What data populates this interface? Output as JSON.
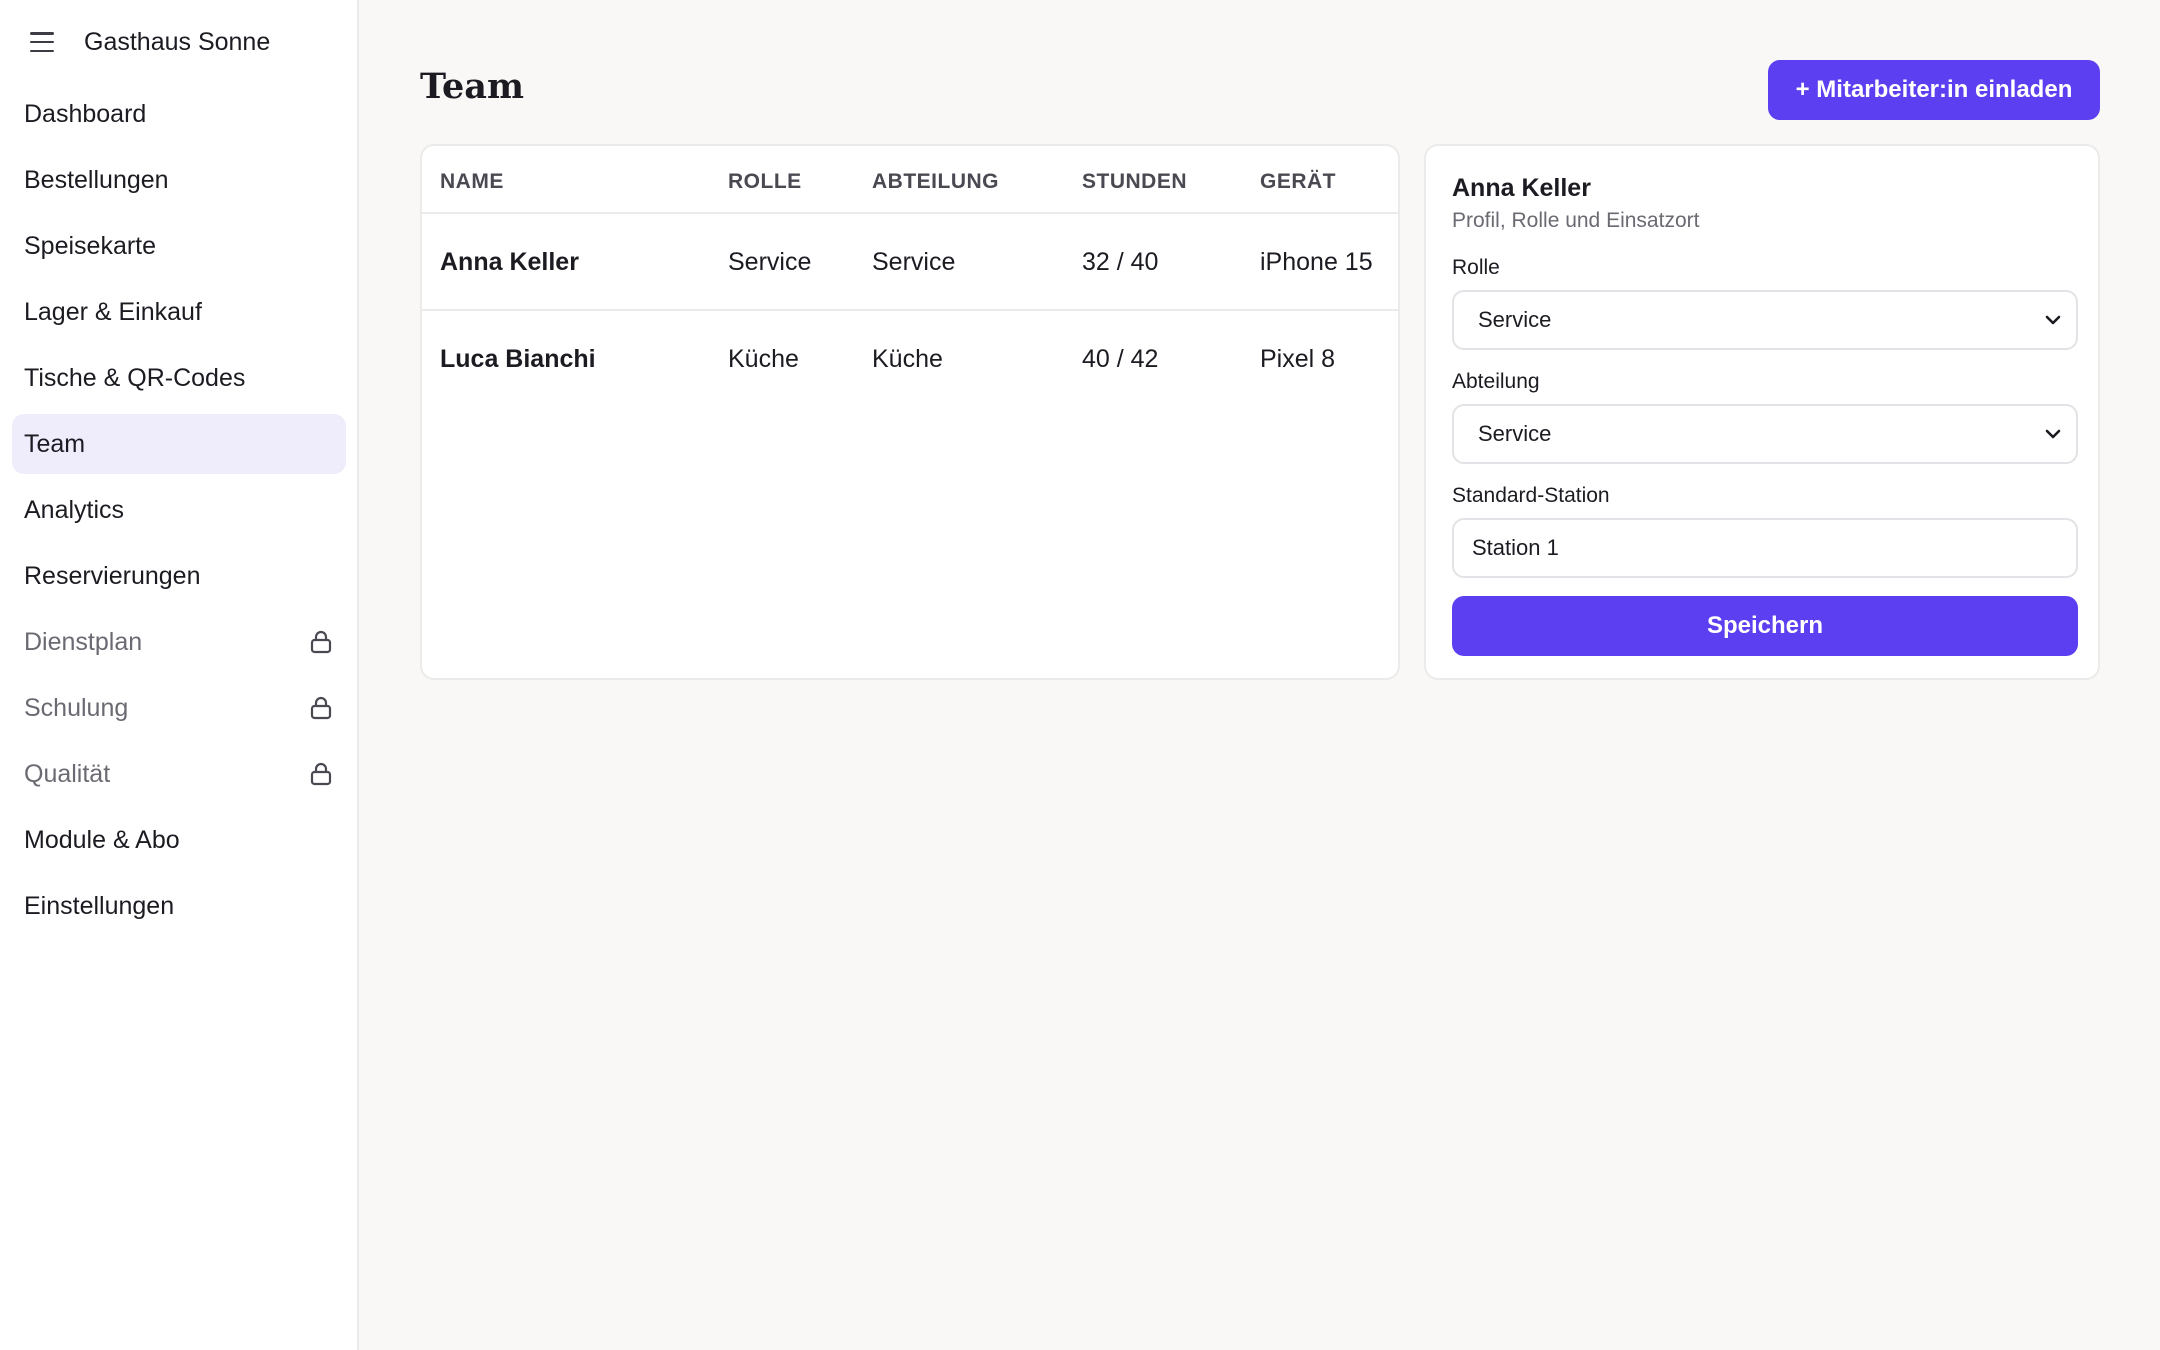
{
  "app": {
    "brand": "Gasthaus Sonne",
    "accent_color": "#5b3ff0"
  },
  "sidebar": {
    "items": [
      {
        "label": "Dashboard",
        "locked": false,
        "active": false
      },
      {
        "label": "Bestellungen",
        "locked": false,
        "active": false
      },
      {
        "label": "Speisekarte",
        "locked": false,
        "active": false
      },
      {
        "label": "Lager & Einkauf",
        "locked": false,
        "active": false
      },
      {
        "label": "Tische & QR-Codes",
        "locked": false,
        "active": false
      },
      {
        "label": "Team",
        "locked": false,
        "active": true
      },
      {
        "label": "Analytics",
        "locked": false,
        "active": false
      },
      {
        "label": "Reservierungen",
        "locked": false,
        "active": false
      },
      {
        "label": "Dienstplan",
        "locked": true,
        "active": false,
        "icon": "lock-icon"
      },
      {
        "label": "Schulung",
        "locked": true,
        "active": false,
        "icon": "lock-icon"
      },
      {
        "label": "Qualität",
        "locked": true,
        "active": false,
        "icon": "lock-icon"
      },
      {
        "label": "Module & Abo",
        "locked": false,
        "active": false
      },
      {
        "label": "Einstellungen",
        "locked": false,
        "active": false
      }
    ]
  },
  "page": {
    "title": "Team",
    "invite_label": "+ Mitarbeiter:in einladen"
  },
  "table": {
    "columns": [
      "NAME",
      "ROLLE",
      "ABTEILUNG",
      "STUNDEN",
      "GERÄT"
    ],
    "rows": [
      {
        "name": "Anna Keller",
        "rolle": "Service",
        "abteilung": "Service",
        "stunden": "32 / 40",
        "geraet": "iPhone 15"
      },
      {
        "name": "Luca Bianchi",
        "rolle": "Küche",
        "abteilung": "Küche",
        "stunden": "40 / 42",
        "geraet": "Pixel 8"
      }
    ]
  },
  "detail": {
    "name": "Anna Keller",
    "subtitle": "Profil, Rolle und Einsatzort",
    "role_label": "Rolle",
    "role_value": "Service",
    "department_label": "Abteilung",
    "department_value": "Service",
    "station_label": "Standard-Station",
    "station_value": "Station 1",
    "save_label": "Speichern"
  }
}
